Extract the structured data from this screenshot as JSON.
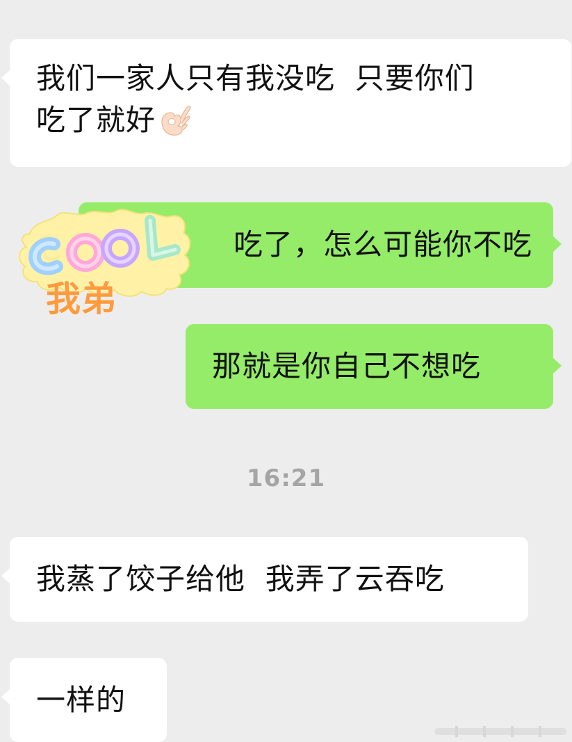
{
  "chat": {
    "messages": [
      {
        "id": "msg1",
        "direction": "incoming",
        "text": "我们一家人只有我没吃  只要你们\n吃了就好",
        "emoji_icon": "ok-hand-emoji"
      },
      {
        "id": "msg2",
        "direction": "outgoing",
        "text": "吃了，怎么可能你不吃"
      },
      {
        "id": "msg3",
        "direction": "outgoing",
        "text": "那就是你自己不想吃"
      },
      {
        "id": "msg4",
        "direction": "incoming",
        "text": "我蒸了饺子给他  我弄了云吞吃"
      },
      {
        "id": "msg5",
        "direction": "incoming",
        "text": "一样的"
      }
    ],
    "timestamp": "16:21",
    "sticker": {
      "logo_text": "COOL",
      "caption": "我弟"
    }
  },
  "colors": {
    "background": "#ededed",
    "incoming_bubble": "#ffffff",
    "outgoing_bubble": "#95ec69",
    "timestamp": "#a5a5a5",
    "sticker_caption": "#ff9b3d"
  }
}
